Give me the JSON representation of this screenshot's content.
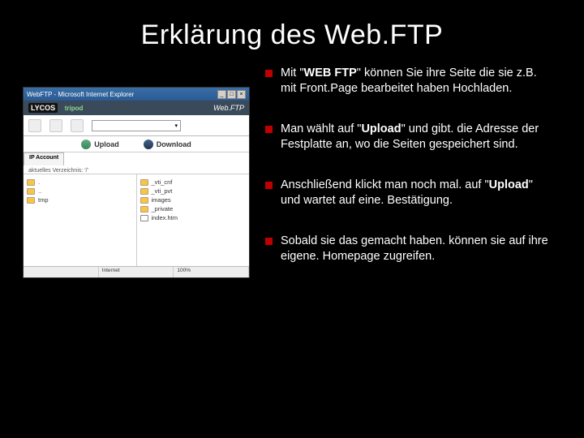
{
  "title": "Erklärung des Web.FTP",
  "bullets": [
    {
      "pre": "Mit \"",
      "bold": "WEB FTP",
      "post": "\" können Sie ihre Seite die sie z.B. mit Front.Page bearbeitet haben Hochladen."
    },
    {
      "pre": "Man wählt auf \"",
      "bold": "Upload",
      "post": "\" und gibt. die Adresse der Festplatte an, wo die Seiten gespeichert sind."
    },
    {
      "pre": "Anschließend klickt man noch mal. auf \"",
      "bold": "Upload",
      "post": "\" und wartet auf eine. Bestätigung."
    },
    {
      "pre": "Sobald sie das gemacht haben. können sie auf ihre eigene. Homepage zugreifen.",
      "bold": "",
      "post": ""
    }
  ],
  "browser": {
    "title": "WebFTP - Microsoft Internet Explorer",
    "brand_left": "LYCOS",
    "brand_tripod": "tripod",
    "brand_right": "Web.FTP",
    "dropdown_value": "",
    "actions": {
      "upload": "Upload",
      "download": "Download"
    },
    "tabs": {
      "left": "IP Account",
      "right_label": "aktuelles Verzeichnis: '/'"
    },
    "left_items": [
      ".",
      "..",
      "tmp"
    ],
    "right_items": [
      "_vti_cnf",
      "_vti_pvt",
      "images",
      "_private",
      "index.htm"
    ],
    "status": {
      "a": "",
      "b": "Internet",
      "c": "100%"
    }
  }
}
